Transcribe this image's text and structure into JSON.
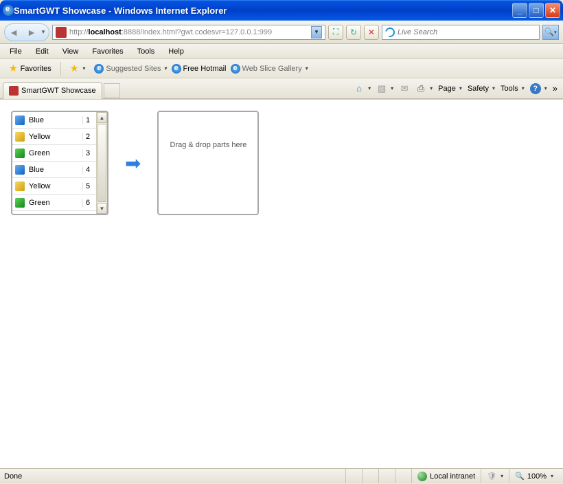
{
  "window": {
    "title": "SmartGWT Showcase - Windows Internet Explorer"
  },
  "address": {
    "protocol": "http://",
    "host": "localhost",
    "rest": ":8888/index.html?gwt.codesvr=127.0.0.1:999"
  },
  "search": {
    "placeholder": "Live Search"
  },
  "menu": {
    "file": "File",
    "edit": "Edit",
    "view": "View",
    "favorites": "Favorites",
    "tools": "Tools",
    "help": "Help"
  },
  "favbar": {
    "favorites": "Favorites",
    "suggested": "Suggested Sites",
    "hotmail": "Free Hotmail",
    "webslice": "Web Slice Gallery"
  },
  "tab": {
    "title": "SmartGWT Showcase"
  },
  "commands": {
    "page": "Page",
    "safety": "Safety",
    "tools": "Tools"
  },
  "list": {
    "items": [
      {
        "color": "blue",
        "name": "Blue",
        "num": "1"
      },
      {
        "color": "yellow",
        "name": "Yellow",
        "num": "2"
      },
      {
        "color": "green",
        "name": "Green",
        "num": "3"
      },
      {
        "color": "blue",
        "name": "Blue",
        "num": "4"
      },
      {
        "color": "yellow",
        "name": "Yellow",
        "num": "5"
      },
      {
        "color": "green",
        "name": "Green",
        "num": "6"
      }
    ]
  },
  "dropzone": {
    "text": "Drag & drop parts here"
  },
  "status": {
    "left": "Done",
    "zone": "Local intranet",
    "zoom": "100%"
  }
}
